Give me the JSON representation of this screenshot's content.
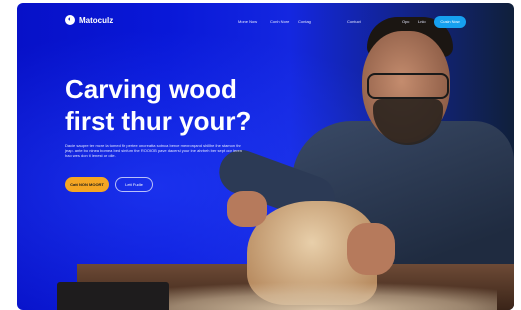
{
  "brand": {
    "name": "Matoculz"
  },
  "nav": {
    "links": [
      "Mone Now",
      "Conh Nore",
      "Contag",
      "Contuct",
      "Opc",
      "Lnlo"
    ],
    "cta": "Cusin Now"
  },
  "hero": {
    "headline": "Carving wood first thur your?",
    "subtext": "Dacie saupre ter mcre la tomed fir pertee oncreatta sotnca berce mexrorqand shillhe ihe stamon thr jeap. ante bo ninea bomea bed sinfum the ROOIOB pave dacersi your ine ahrbeh ber sept oor leren hao wes don ti lenest or olle.",
    "primary_button": "Catt NON MOORT",
    "secondary_button": "Lett Fudle"
  },
  "colors": {
    "background": "#0711c8",
    "cta": "#16a0f0",
    "primary_button": "#f5a623"
  }
}
